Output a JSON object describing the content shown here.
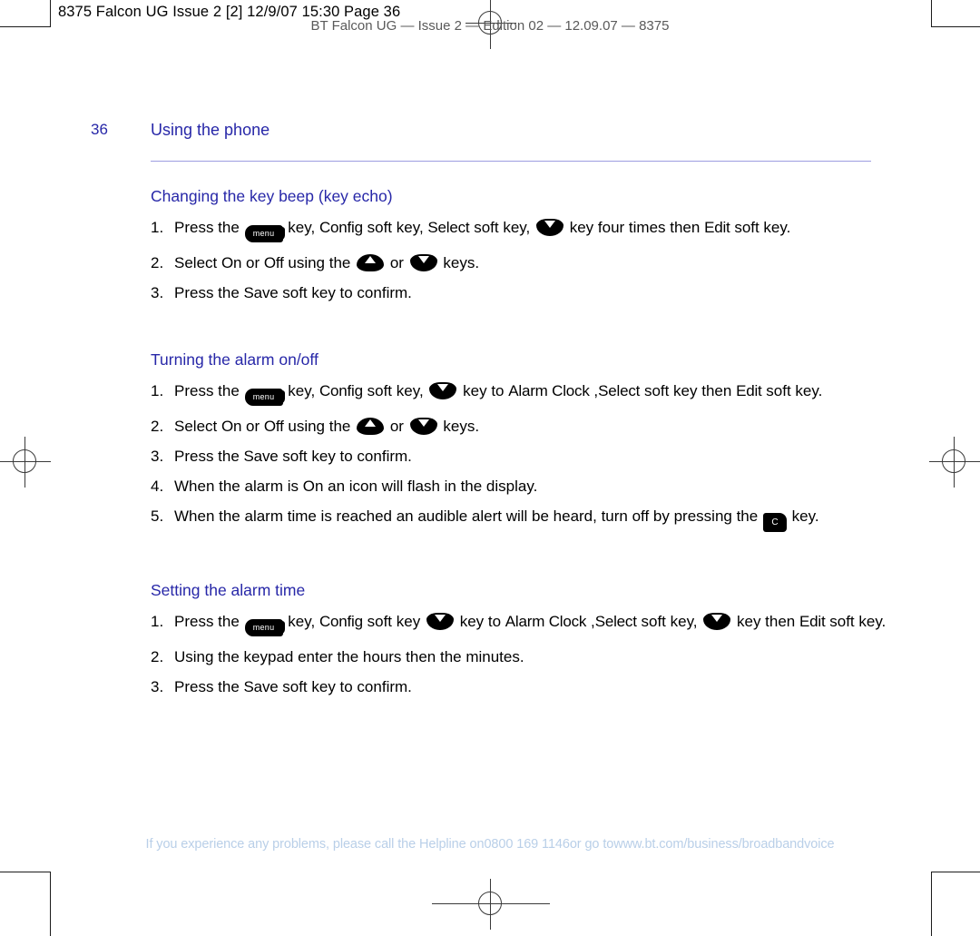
{
  "imposition": {
    "slug_left": "8375 Falcon UG Issue 2 [2]  12/9/07  15:30  Page 36",
    "slug_center": "BT Falcon UG — Issue 2 — Edition 02 — 12.09.07 — 8375"
  },
  "page": {
    "number": "36",
    "running_head": "Using the phone"
  },
  "sections": [
    {
      "title": "Changing the key beep (key echo)",
      "steps": [
        {
          "num": "1.",
          "parts": [
            {
              "type": "text",
              "value": "Press the"
            },
            {
              "type": "icon",
              "icon": "menu-key-icon",
              "label": "menu"
            },
            {
              "type": "text",
              "value": "key,"
            },
            {
              "type": "term",
              "value": "Config"
            },
            {
              "type": "text",
              "value": "soft key,"
            },
            {
              "type": "term",
              "value": "Select"
            },
            {
              "type": "text",
              "value": "soft key,"
            },
            {
              "type": "icon",
              "icon": "nav-down-key-icon",
              "label": ""
            },
            {
              "type": "text",
              "value": "key four times then"
            },
            {
              "type": "term",
              "value": "Edit"
            },
            {
              "type": "text",
              "value": "soft key."
            }
          ]
        },
        {
          "num": "2.",
          "parts": [
            {
              "type": "text",
              "value": "Select"
            },
            {
              "type": "term",
              "value": "On"
            },
            {
              "type": "text",
              "value": "or"
            },
            {
              "type": "term",
              "value": "Off"
            },
            {
              "type": "text",
              "value": "using the"
            },
            {
              "type": "icon",
              "icon": "nav-up-key-icon",
              "label": ""
            },
            {
              "type": "text",
              "value": "or"
            },
            {
              "type": "icon",
              "icon": "nav-down-key-icon",
              "label": ""
            },
            {
              "type": "text",
              "value": "keys."
            }
          ]
        },
        {
          "num": "3.",
          "parts": [
            {
              "type": "text",
              "value": "Press the"
            },
            {
              "type": "term",
              "value": "Save"
            },
            {
              "type": "text",
              "value": "soft key to confirm."
            }
          ]
        }
      ]
    },
    {
      "title": "Turning the alarm on/off",
      "steps": [
        {
          "num": "1.",
          "parts": [
            {
              "type": "text",
              "value": "Press the"
            },
            {
              "type": "icon",
              "icon": "menu-key-icon",
              "label": "menu"
            },
            {
              "type": "text",
              "value": "key,"
            },
            {
              "type": "term",
              "value": "Config"
            },
            {
              "type": "text",
              "value": "soft key,"
            },
            {
              "type": "icon",
              "icon": "nav-down-key-icon",
              "label": ""
            },
            {
              "type": "text",
              "value": "key to"
            },
            {
              "type": "term",
              "value": "Alarm Clock"
            },
            {
              "type": "text",
              "value": ","
            },
            {
              "type": "term",
              "value": "Select"
            },
            {
              "type": "text",
              "value": "soft key then"
            },
            {
              "type": "term",
              "value": "Edit"
            },
            {
              "type": "text",
              "value": "soft key."
            }
          ]
        },
        {
          "num": "2.",
          "parts": [
            {
              "type": "text",
              "value": "Select"
            },
            {
              "type": "term",
              "value": "On"
            },
            {
              "type": "text",
              "value": "or"
            },
            {
              "type": "term",
              "value": "Off"
            },
            {
              "type": "text",
              "value": "using the"
            },
            {
              "type": "icon",
              "icon": "nav-up-key-icon",
              "label": ""
            },
            {
              "type": "text",
              "value": "or"
            },
            {
              "type": "icon",
              "icon": "nav-down-key-icon",
              "label": ""
            },
            {
              "type": "text",
              "value": "keys."
            }
          ]
        },
        {
          "num": "3.",
          "parts": [
            {
              "type": "text",
              "value": "Press the"
            },
            {
              "type": "term",
              "value": "Save"
            },
            {
              "type": "text",
              "value": "soft key to confirm."
            }
          ]
        },
        {
          "num": "4.",
          "parts": [
            {
              "type": "text",
              "value": "When the alarm is On an icon will flash in the display."
            }
          ]
        },
        {
          "num": "5.",
          "parts": [
            {
              "type": "text",
              "value": "When the alarm time is reached an audible alert will be heard, turn off by pressing the"
            },
            {
              "type": "icon",
              "icon": "clear-key-icon",
              "label": "C"
            },
            {
              "type": "text",
              "value": "key."
            }
          ]
        }
      ]
    },
    {
      "title": "Setting the alarm time",
      "steps": [
        {
          "num": "1.",
          "parts": [
            {
              "type": "text",
              "value": "Press the"
            },
            {
              "type": "icon",
              "icon": "menu-key-icon",
              "label": "menu"
            },
            {
              "type": "text",
              "value": "key,"
            },
            {
              "type": "term",
              "value": "Config"
            },
            {
              "type": "text",
              "value": "soft key"
            },
            {
              "type": "icon",
              "icon": "nav-down-key-icon",
              "label": ""
            },
            {
              "type": "text",
              "value": "key to"
            },
            {
              "type": "term",
              "value": "Alarm Clock"
            },
            {
              "type": "text",
              "value": ","
            },
            {
              "type": "term",
              "value": "Select"
            },
            {
              "type": "text",
              "value": "soft key,"
            },
            {
              "type": "icon",
              "icon": "nav-down-key-icon",
              "label": ""
            },
            {
              "type": "text",
              "value": "key then"
            },
            {
              "type": "term",
              "value": "Edit"
            },
            {
              "type": "text",
              "value": "soft key."
            }
          ]
        },
        {
          "num": "2.",
          "parts": [
            {
              "type": "text",
              "value": "Using the keypad enter the hours then the minutes."
            }
          ]
        },
        {
          "num": "3.",
          "parts": [
            {
              "type": "text",
              "value": "Press the"
            },
            {
              "type": "term",
              "value": "Save"
            },
            {
              "type": "text",
              "value": "soft key to confirm."
            }
          ]
        }
      ]
    }
  ],
  "footer": {
    "lead": "If you experience any problems, please call the Helpline on",
    "phone": "0800 169 1146",
    "mid": "or go to",
    "url": "www.bt.com/business/broadbandvoice"
  },
  "colors": {
    "heading_blue": "#2727a8",
    "rule_blue": "#9d9de0",
    "footer_blue": "#b9cfe8",
    "body_black": "#000000"
  }
}
